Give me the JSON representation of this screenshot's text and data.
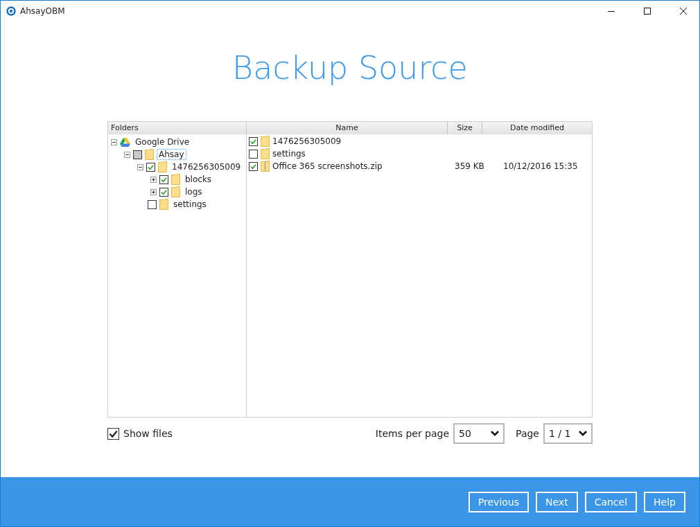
{
  "window": {
    "title": "AhsayOBM"
  },
  "heading": "Backup Source",
  "folders": {
    "header": "Folders",
    "tree": [
      {
        "label": "Google Drive",
        "kind": "drive",
        "expanded": true,
        "selected": false,
        "children": [
          {
            "label": "Ahsay",
            "kind": "folder",
            "checked": false,
            "partial": true,
            "expanded": true,
            "selected": true,
            "children": [
              {
                "label": "1476256305009",
                "kind": "folder",
                "checked": true,
                "partial": false,
                "expanded": true,
                "selected": false,
                "children": [
                  {
                    "label": "blocks",
                    "kind": "folder",
                    "checked": true,
                    "partial": false,
                    "expanded": false,
                    "selected": false
                  },
                  {
                    "label": "logs",
                    "kind": "folder",
                    "checked": true,
                    "partial": false,
                    "expanded": false,
                    "selected": false
                  }
                ]
              },
              {
                "label": "settings",
                "kind": "folder",
                "checked": false,
                "partial": false,
                "selected": false
              }
            ]
          }
        ]
      }
    ]
  },
  "files": {
    "columns": [
      "Name",
      "Size",
      "Date modified"
    ],
    "rows": [
      {
        "name": "1476256305009",
        "kind": "folder",
        "checked": true
      },
      {
        "name": "settings",
        "kind": "folder",
        "checked": false
      },
      {
        "name": "Office 365 screenshots.zip",
        "kind": "zip",
        "checked": true,
        "size": "359 KB",
        "date": "10/12/2016 15:35"
      }
    ]
  },
  "show_files": {
    "label": "Show files",
    "checked": true
  },
  "items_per_page": {
    "label": "Items per page",
    "value": "50"
  },
  "page": {
    "label": "Page",
    "value": "1 / 1"
  },
  "buttons": [
    "Previous",
    "Next",
    "Cancel",
    "Help"
  ]
}
